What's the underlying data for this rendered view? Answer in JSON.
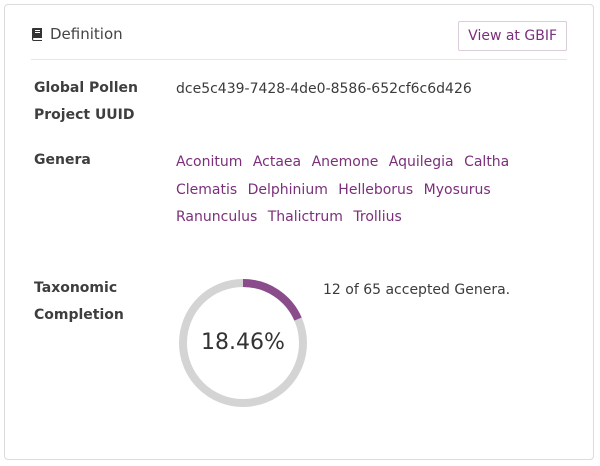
{
  "header": {
    "icon": "book-icon",
    "title": "Definition",
    "gbif_button_label": "View at GBIF"
  },
  "uuid_row": {
    "label_line1": "Global Pollen",
    "label_line2": "Project UUID",
    "value": "dce5c439-7428-4de0-8586-652cf6c6d426"
  },
  "genera_row": {
    "label": "Genera",
    "items": [
      "Aconitum",
      "Actaea",
      "Anemone",
      "Aquilegia",
      "Caltha",
      "Clematis",
      "Delphinium",
      "Helleborus",
      "Myosurus",
      "Ranunculus",
      "Thalictrum",
      "Trollius"
    ]
  },
  "completion_row": {
    "label_line1": "Taxonomic",
    "label_line2": "Completion",
    "percent_text": "18.46%",
    "fraction": 0.1846,
    "summary": "12 of 65 accepted Genera."
  },
  "colors": {
    "accent": "#8b4c8c",
    "ring_track": "#d4d4d4",
    "link": "#7b2f7b"
  }
}
